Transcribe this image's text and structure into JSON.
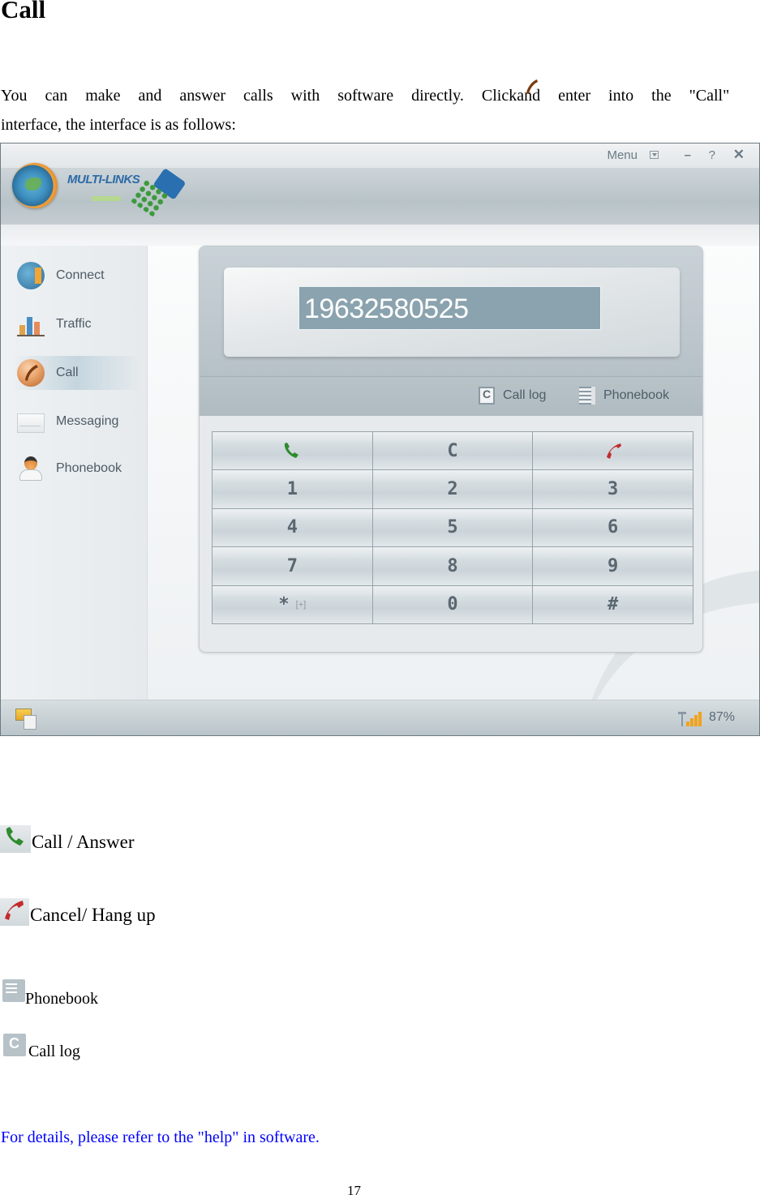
{
  "document": {
    "heading": "Call",
    "intro_before_icon": "You  can  make  and  answer  calls  with  software  directly.  Click",
    "intro_after_icon": "and  enter  into  the  \"Call\"",
    "intro_line2": "interface, the interface is as follows:",
    "inline_icon": "call-handset-icon",
    "page_number": "17",
    "note": "For details, please refer to the \"help\" in software.",
    "note_color": "#0000ff"
  },
  "app": {
    "brand": "MULTI-LINKS",
    "title_controls": {
      "menu_label": "Menu",
      "minimize": "–",
      "help": "?",
      "close": "✕"
    },
    "sidebar": {
      "items": [
        {
          "label": "Connect",
          "icon": "globe-connect-icon",
          "active": false
        },
        {
          "label": "Traffic",
          "icon": "bar-chart-icon",
          "active": false
        },
        {
          "label": "Call",
          "icon": "call-handset-icon",
          "active": true
        },
        {
          "label": "Messaging",
          "icon": "envelope-icon",
          "active": false
        },
        {
          "label": "Phonebook",
          "icon": "contact-person-icon",
          "active": false
        }
      ]
    },
    "dialer": {
      "number": "19632580525",
      "links": {
        "call_log": "Call log",
        "phonebook": "Phonebook"
      },
      "keys": [
        {
          "label": "📞",
          "role": "call",
          "sub": ""
        },
        {
          "label": "C",
          "role": "clear",
          "sub": ""
        },
        {
          "label": "📞",
          "role": "hang-up",
          "sub": ""
        },
        {
          "label": "1",
          "role": "digit",
          "sub": ""
        },
        {
          "label": "2",
          "role": "digit",
          "sub": ""
        },
        {
          "label": "3",
          "role": "digit",
          "sub": ""
        },
        {
          "label": "4",
          "role": "digit",
          "sub": ""
        },
        {
          "label": "5",
          "role": "digit",
          "sub": ""
        },
        {
          "label": "6",
          "role": "digit",
          "sub": ""
        },
        {
          "label": "7",
          "role": "digit",
          "sub": ""
        },
        {
          "label": "8",
          "role": "digit",
          "sub": ""
        },
        {
          "label": "9",
          "role": "digit",
          "sub": ""
        },
        {
          "label": "*",
          "role": "star",
          "sub": "[+]"
        },
        {
          "label": "0",
          "role": "digit",
          "sub": ""
        },
        {
          "label": "#",
          "role": "hash",
          "sub": ""
        }
      ],
      "call_color": "#2e8b2e",
      "hangup_color": "#c22c2c"
    },
    "status": {
      "signal_strength": "87%"
    }
  },
  "legend": [
    {
      "icon": "call-answer-icon",
      "text": "Call / Answer"
    },
    {
      "icon": "hang-up-icon",
      "text": "Cancel/ Hang up"
    },
    {
      "icon": "phonebook-icon",
      "text": "Phonebook"
    },
    {
      "icon": "call-log-icon",
      "text": "Call log"
    }
  ]
}
